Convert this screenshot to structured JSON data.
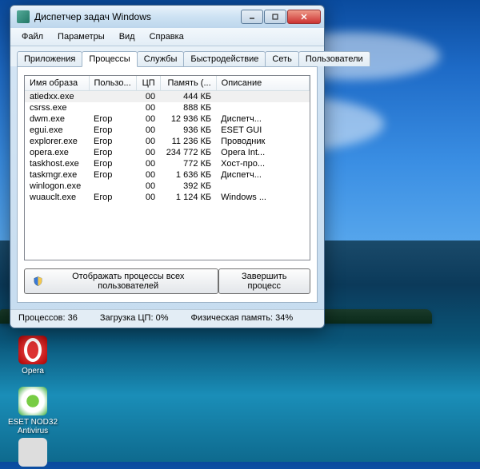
{
  "window": {
    "title": "Диспетчер задач Windows"
  },
  "menu": [
    "Файл",
    "Параметры",
    "Вид",
    "Справка"
  ],
  "tabs": [
    "Приложения",
    "Процессы",
    "Службы",
    "Быстродействие",
    "Сеть",
    "Пользователи"
  ],
  "activeTab": 1,
  "columns": [
    "Имя образа",
    "Пользо...",
    "ЦП",
    "Память (...",
    "Описание"
  ],
  "processes": [
    {
      "name": "atiedxx.exe",
      "user": "",
      "cpu": "00",
      "mem": "444 КБ",
      "desc": "",
      "selected": true
    },
    {
      "name": "csrss.exe",
      "user": "",
      "cpu": "00",
      "mem": "888 КБ",
      "desc": ""
    },
    {
      "name": "dwm.exe",
      "user": "Егор",
      "cpu": "00",
      "mem": "12 936 КБ",
      "desc": "Диспетч..."
    },
    {
      "name": "egui.exe",
      "user": "Егор",
      "cpu": "00",
      "mem": "936 КБ",
      "desc": "ESET GUI"
    },
    {
      "name": "explorer.exe",
      "user": "Егор",
      "cpu": "00",
      "mem": "11 236 КБ",
      "desc": "Проводник"
    },
    {
      "name": "opera.exe",
      "user": "Егор",
      "cpu": "00",
      "mem": "234 772 КБ",
      "desc": "Opera Int..."
    },
    {
      "name": "taskhost.exe",
      "user": "Егор",
      "cpu": "00",
      "mem": "772 КБ",
      "desc": "Хост-про..."
    },
    {
      "name": "taskmgr.exe",
      "user": "Егор",
      "cpu": "00",
      "mem": "1 636 КБ",
      "desc": "Диспетч..."
    },
    {
      "name": "winlogon.exe",
      "user": "",
      "cpu": "00",
      "mem": "392 КБ",
      "desc": ""
    },
    {
      "name": "wuauclt.exe",
      "user": "Егор",
      "cpu": "00",
      "mem": "1 124 КБ",
      "desc": "Windows ..."
    }
  ],
  "buttons": {
    "showAll": "Отображать процессы всех пользователей",
    "end": "Завершить процесс"
  },
  "status": {
    "procs": "Процессов: 36",
    "cpu": "Загрузка ЦП: 0%",
    "mem": "Физическая память: 34%"
  },
  "desktop": {
    "opera": "Opera",
    "eset": "ESET NOD32 Antivirus"
  }
}
